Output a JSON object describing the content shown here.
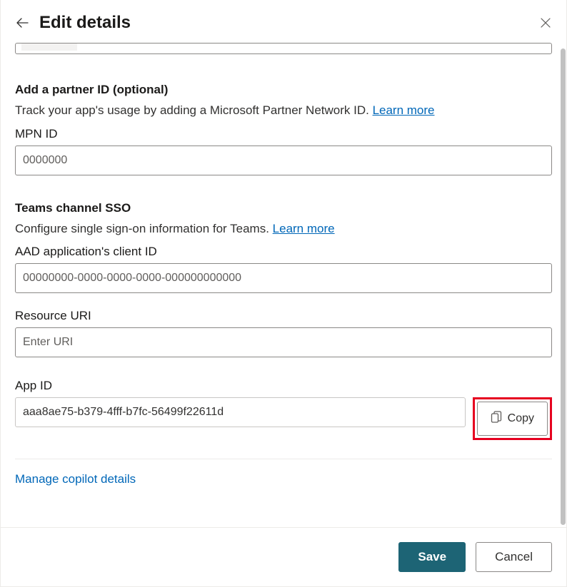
{
  "header": {
    "title": "Edit details"
  },
  "partnerSection": {
    "heading": "Add a partner ID (optional)",
    "description": "Track your app's usage by adding a Microsoft Partner Network ID. ",
    "learn_more": "Learn more",
    "mpn_label": "MPN ID",
    "mpn_placeholder": "0000000",
    "mpn_value": ""
  },
  "ssoSection": {
    "heading": "Teams channel SSO",
    "description": "Configure single sign-on information for Teams. ",
    "learn_more": "Learn more",
    "aad_label": "AAD application's client ID",
    "aad_placeholder": "00000000-0000-0000-0000-000000000000",
    "aad_value": "",
    "resource_label": "Resource URI",
    "resource_placeholder": "Enter URI",
    "resource_value": ""
  },
  "appIdSection": {
    "label": "App ID",
    "value": "aaa8ae75-b379-4fff-b7fc-56499f22611d",
    "copy_label": "Copy"
  },
  "manage_link": "Manage copilot details",
  "footer": {
    "save": "Save",
    "cancel": "Cancel"
  }
}
